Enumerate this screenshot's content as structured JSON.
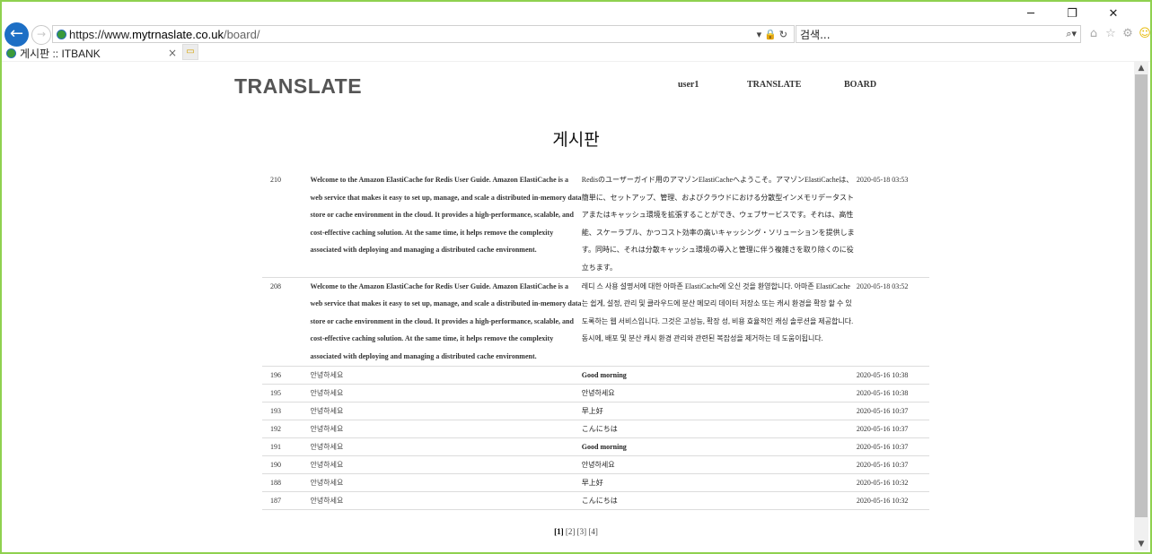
{
  "browser": {
    "url_scheme": "https://www.",
    "url_host": "mytrnaslate.co.uk",
    "url_path": "/board/",
    "search_placeholder": "검색...",
    "tab_title": "게시판 :: ITBANK",
    "win_minimize": "─",
    "win_restore": "❐",
    "win_close": "✕",
    "back_icon": "←",
    "fwd_icon": "→",
    "address_tools": "▾🔒↻",
    "search_tools": "⌕▾",
    "tab_close": "×"
  },
  "header": {
    "brand": "TRANSLATE",
    "nav": [
      "user1",
      "TRANSLATE",
      "BOARD"
    ]
  },
  "page_title": "게시판",
  "rows": [
    {
      "id": "210",
      "source": "Welcome to the Amazon ElastiCache for Redis User Guide. Amazon ElastiCache is a web service that makes it easy to set up, manage, and scale a distributed in-memory data store or cache environment in the cloud. It provides a high-performance, scalable, and cost-effective caching solution. At the same time, it helps remove the complexity associated with deploying and managing a distributed cache environment.",
      "translation": "Redisのユーザーガイド用のアマゾンElastiCacheへようこそ。アマゾンElastiCacheは、簡単に、セットアップ、管理、およびクラウドにおける分散型インメモリデータストアまたはキャッシュ環境を拡張することができ、ウェブサービスです。それは、高性能、スケーラブル、かつコスト効率の高いキャッシング・ソリューションを提供します。同時に、それは分散キャッシュ環境の導入と管理に伴う複雑さを取り除くのに役立ちます。",
      "date": "2020-05-18 03:53"
    },
    {
      "id": "208",
      "source": "Welcome to the Amazon ElastiCache for Redis User Guide. Amazon ElastiCache is a web service that makes it easy to set up, manage, and scale a distributed in-memory data store or cache environment in the cloud. It provides a high-performance, scalable, and cost-effective caching solution. At the same time, it helps remove the complexity associated with deploying and managing a distributed cache environment.",
      "translation": "레디 스 사용 설명서에 대한 아마존 ElastiCache에 오신 것을 환영합니다. 아마존 ElastiCache는 쉽게, 설정, 관리 및 클라우드에 분산 메모리 데이터 저장소 또는 캐시 환경을 확장 할 수 있도록하는 웹 서비스입니다. 그것은 고성능, 확장 성, 비용 효율적인 캐싱 솔루션을 제공합니다. 동시에, 배포 및 분산 캐시 환경 관리와 관련된 복잡성을 제거하는 데 도움이됩니다.",
      "date": "2020-05-18 03:52"
    },
    {
      "id": "196",
      "source": "안녕하세요",
      "translation": "Good morning",
      "date": "2020-05-16 10:38"
    },
    {
      "id": "195",
      "source": "안녕하세요",
      "translation": "안녕하세요",
      "date": "2020-05-16 10:38"
    },
    {
      "id": "193",
      "source": "안녕하세요",
      "translation": "早上好",
      "date": "2020-05-16 10:37"
    },
    {
      "id": "192",
      "source": "안녕하세요",
      "translation": "こんにちは",
      "date": "2020-05-16 10:37"
    },
    {
      "id": "191",
      "source": "안녕하세요",
      "translation": "Good morning",
      "date": "2020-05-16 10:37"
    },
    {
      "id": "190",
      "source": "안녕하세요",
      "translation": "안녕하세요",
      "date": "2020-05-16 10:37"
    },
    {
      "id": "188",
      "source": "안녕하세요",
      "translation": "早上好",
      "date": "2020-05-16 10:32"
    },
    {
      "id": "187",
      "source": "안녕하세요",
      "translation": "こんにちは",
      "date": "2020-05-16 10:32"
    }
  ],
  "pagination": {
    "current": "[1]",
    "pages": [
      "[2]",
      "[3]",
      "[4]"
    ]
  },
  "colors": {
    "frame": "#8fd14f",
    "back_button": "#1d6fc5",
    "brand_text": "#555555"
  }
}
